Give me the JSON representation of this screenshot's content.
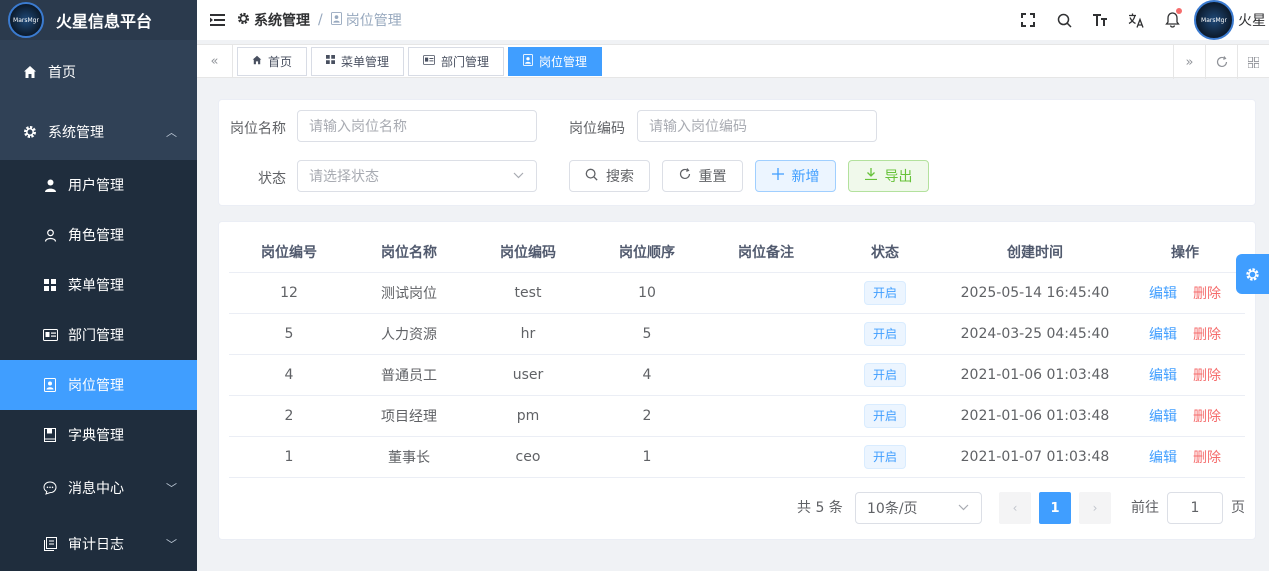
{
  "app": {
    "title": "火星信息平台",
    "logo_text": "MarsMgr"
  },
  "sidebar": {
    "items": [
      {
        "label": "首页",
        "icon": "home-icon"
      },
      {
        "label": "系统管理",
        "icon": "gear-icon",
        "expanded": true
      }
    ],
    "sub_items": [
      {
        "label": "用户管理",
        "icon": "user-icon"
      },
      {
        "label": "角色管理",
        "icon": "person-outline-icon"
      },
      {
        "label": "菜单管理",
        "icon": "grid-icon"
      },
      {
        "label": "部门管理",
        "icon": "id-card-icon"
      },
      {
        "label": "岗位管理",
        "icon": "post-icon",
        "active": true
      },
      {
        "label": "字典管理",
        "icon": "book-icon"
      },
      {
        "label": "消息中心",
        "icon": "chat-icon",
        "has_children": true
      },
      {
        "label": "审计日志",
        "icon": "log-icon",
        "has_children": true
      }
    ]
  },
  "header": {
    "breadcrumb": [
      "系统管理",
      "岗位管理"
    ],
    "user_name": "火星"
  },
  "tags": [
    {
      "label": "首页",
      "icon": "home-icon"
    },
    {
      "label": "菜单管理",
      "icon": "grid-icon"
    },
    {
      "label": "部门管理",
      "icon": "id-card-icon"
    },
    {
      "label": "岗位管理",
      "icon": "post-icon",
      "active": true
    }
  ],
  "search": {
    "post_name_label": "岗位名称",
    "post_name_placeholder": "请输入岗位名称",
    "post_code_label": "岗位编码",
    "post_code_placeholder": "请输入岗位编码",
    "status_label": "状态",
    "status_placeholder": "请选择状态",
    "search_btn": "搜索",
    "reset_btn": "重置",
    "add_btn": "新增",
    "export_btn": "导出"
  },
  "table": {
    "columns": [
      "岗位编号",
      "岗位名称",
      "岗位编码",
      "岗位顺序",
      "岗位备注",
      "状态",
      "创建时间",
      "操作"
    ],
    "rows": [
      {
        "id": "12",
        "name": "测试岗位",
        "code": "test",
        "order": "10",
        "remark": "",
        "status": "开启",
        "created": "2025-05-14 16:45:40"
      },
      {
        "id": "5",
        "name": "人力资源",
        "code": "hr",
        "order": "5",
        "remark": "",
        "status": "开启",
        "created": "2024-03-25 04:45:40"
      },
      {
        "id": "4",
        "name": "普通员工",
        "code": "user",
        "order": "4",
        "remark": "",
        "status": "开启",
        "created": "2021-01-06 01:03:48"
      },
      {
        "id": "2",
        "name": "项目经理",
        "code": "pm",
        "order": "2",
        "remark": "",
        "status": "开启",
        "created": "2021-01-06 01:03:48"
      },
      {
        "id": "1",
        "name": "董事长",
        "code": "ceo",
        "order": "1",
        "remark": "",
        "status": "开启",
        "created": "2021-01-07 01:03:48"
      }
    ],
    "edit_label": "编辑",
    "delete_label": "删除"
  },
  "pagination": {
    "total_text": "共 5 条",
    "page_size": "10条/页",
    "current_page": "1",
    "goto_label": "前往",
    "goto_value": "1",
    "page_suffix": "页"
  },
  "colors": {
    "primary": "#409eff",
    "sidebar_bg": "#304156",
    "danger": "#f56c6c",
    "success": "#67c23a"
  }
}
